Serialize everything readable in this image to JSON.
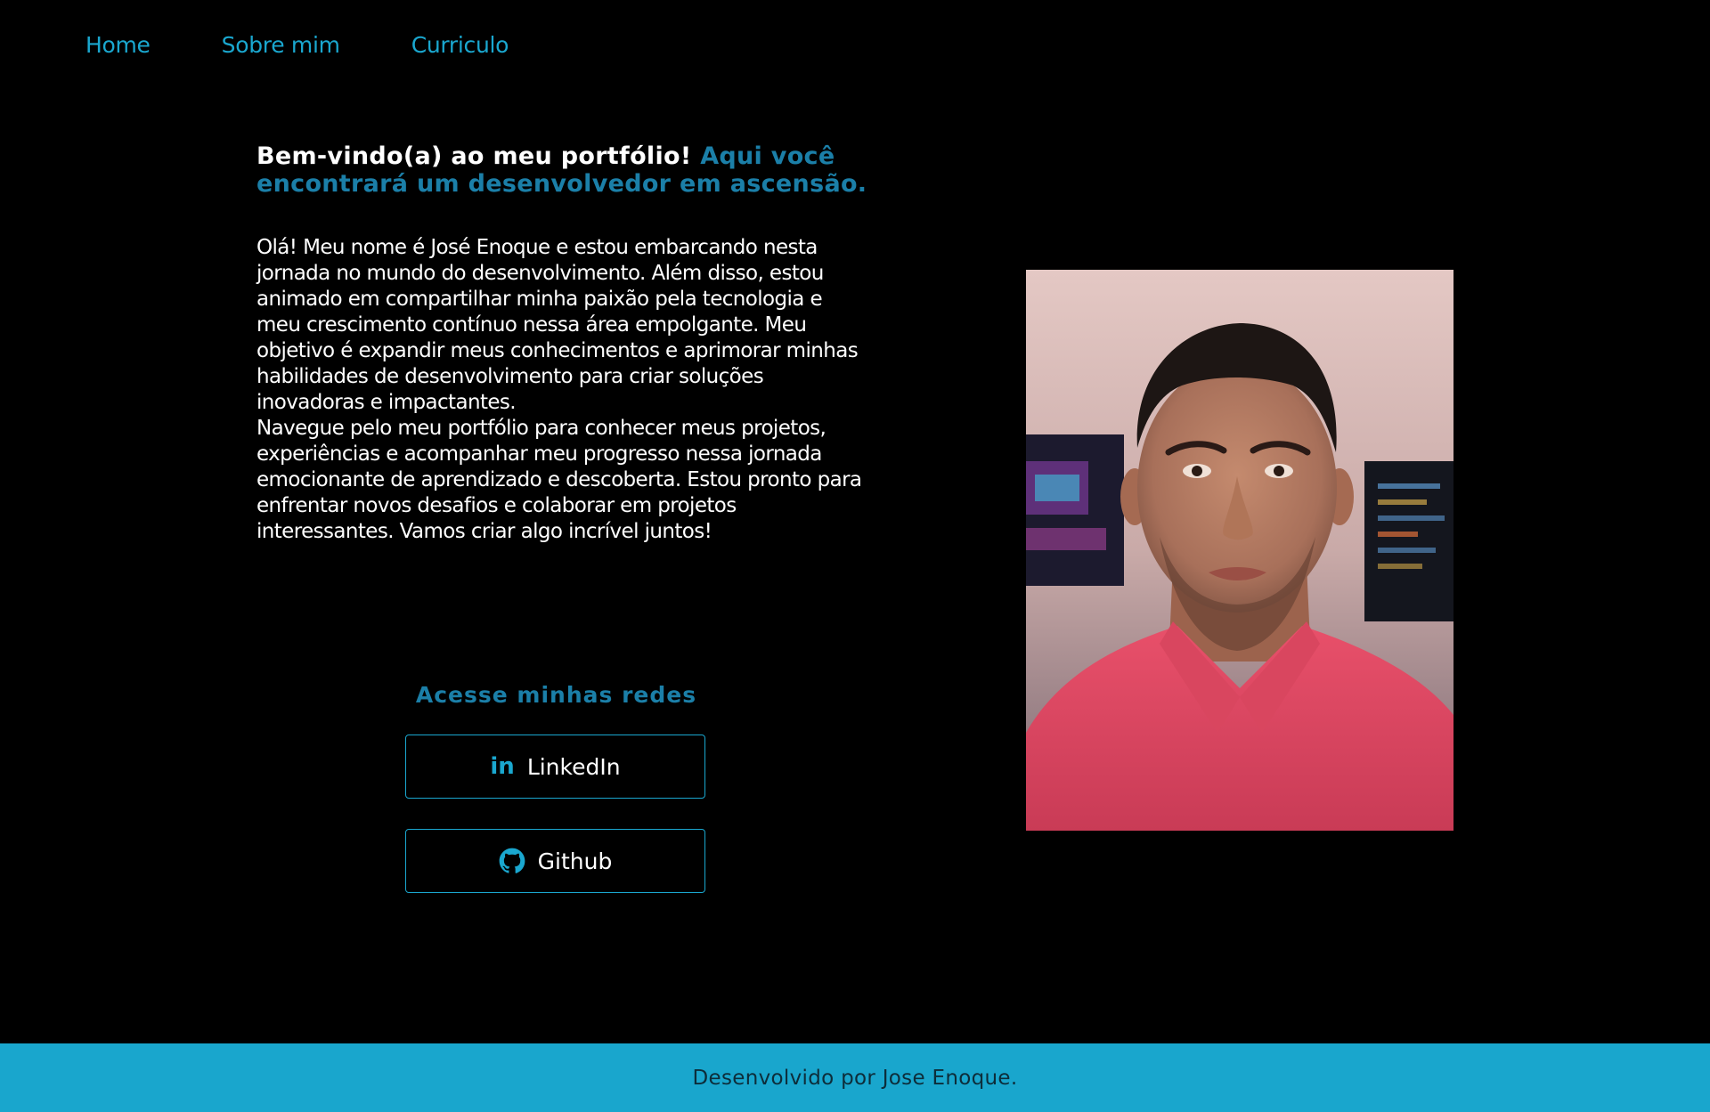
{
  "nav": {
    "items": [
      "Home",
      "Sobre mim",
      "Curriculo"
    ]
  },
  "headline": {
    "white_part": "Bem-vindo(a) ao meu portfólio!",
    "blue_part": "Aqui você encontrará um desenvolvedor em ascensão."
  },
  "intro": {
    "paragraph1": "Olá! Meu nome é José Enoque e estou embarcando nesta jornada no mundo do desenvolvimento. Além disso, estou animado em compartilhar minha paixão pela tecnologia e meu crescimento contínuo nessa área empolgante. Meu objetivo é expandir meus conhecimentos e aprimorar minhas habilidades de desenvolvimento para criar soluções inovadoras e impactantes.",
    "paragraph2": "Navegue pelo meu portfólio para conhecer meus projetos, experiências e acompanhar meu progresso nessa jornada emocionante de aprendizado e descoberta. Estou pronto para enfrentar novos desafios e colaborar em projetos interessantes. Vamos criar algo incrível juntos!"
  },
  "social": {
    "title": "Acesse minhas redes",
    "linkedin_label": "LinkedIn",
    "github_label": "Github"
  },
  "footer": {
    "text": "Desenvolvido por Jose Enoque."
  },
  "colors": {
    "accent": "#1aa7cf",
    "heading_blue": "#1b7fa8",
    "background": "#000000",
    "footer_bg": "#19a6cd"
  }
}
